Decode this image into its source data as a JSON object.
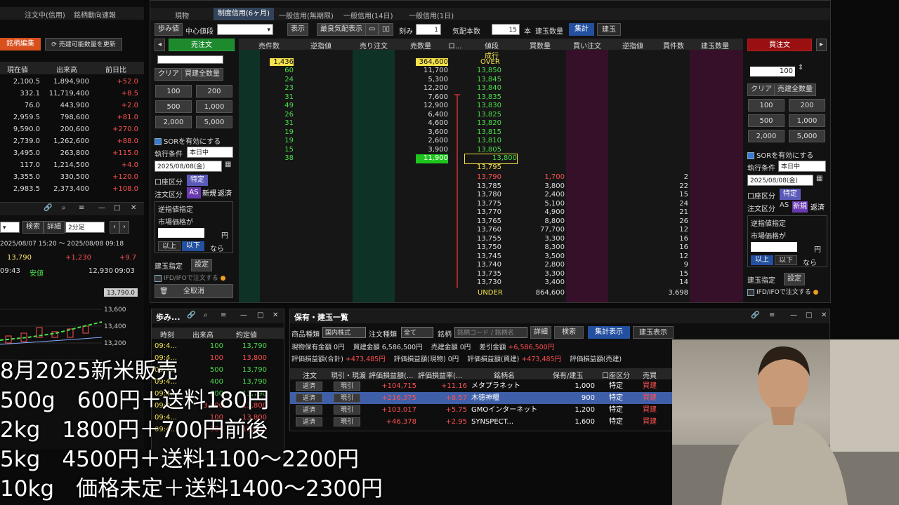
{
  "top_left_tabs": [
    "注文中(信用)",
    "銘柄動向速報"
  ],
  "left_list": {
    "edit_btn": "銘柄編集",
    "update_btn": "売建可能数量を更新",
    "headers": [
      "現在値",
      "出来高",
      "前日比"
    ],
    "rows": [
      {
        "price": "2,100.5",
        "vol": "1,894,900",
        "chg": "+52.0"
      },
      {
        "price": "332.1",
        "vol": "11,719,400",
        "chg": "+8.5"
      },
      {
        "price": "76.0",
        "vol": "443,900",
        "chg": "+2.0"
      },
      {
        "price": "2,959.5",
        "vol": "798,600",
        "chg": "+81.0"
      },
      {
        "price": "9,590.0",
        "vol": "200,600",
        "chg": "+270.0"
      },
      {
        "price": "2,739.0",
        "vol": "1,262,600",
        "chg": "+88.0"
      },
      {
        "price": "3,495.0",
        "vol": "263,800",
        "chg": "+115.0"
      },
      {
        "price": "117.0",
        "vol": "1,214,500",
        "chg": "+4.0"
      },
      {
        "price": "3,355.0",
        "vol": "330,500",
        "chg": "+120.0"
      },
      {
        "price": "2,983.5",
        "vol": "2,373,400",
        "chg": "+108.0"
      }
    ]
  },
  "chart_panel": {
    "search": "検索",
    "detail": "詳細",
    "interval": "2分足",
    "range": "2025/08/07 15:20 ～ 2025/08/08 09:18",
    "price": "13,790",
    "change": "+1,230",
    "change_pct": "+9.7",
    "time1": "09:43",
    "low_label": "安値",
    "low_value": "12,930",
    "low_time": "09:03",
    "current_tag": "13,790.0",
    "yticks": [
      "13,600",
      "13,400",
      "13,200"
    ]
  },
  "board": {
    "tabs": [
      "現物",
      "制度信用(6ヶ月)",
      "一般信用(無期限)",
      "一般信用(14日)",
      "一般信用(1日)"
    ],
    "active_tab": 1,
    "toolbar": {
      "ayumi": "歩み値",
      "center": "中心値段",
      "display": "表示",
      "best": "最良気配表示",
      "kizami": "刻み",
      "kizami_val": "1",
      "kehai_count_label": "気配本数",
      "kehai_count": "15",
      "hon": "本",
      "tategyoku_qty": "建玉数量",
      "shukei": "集計",
      "tategyoku": "建玉"
    },
    "sell_order_btn": "売注文",
    "buy_order_btn": "買注文",
    "columns": [
      "売件数",
      "逆指値",
      "売り注文",
      "売数量",
      "ロ...",
      "値段",
      "買数量",
      "買い注文",
      "逆指値",
      "買件数",
      "建玉数量"
    ],
    "top_row": {
      "label": "成行"
    },
    "over_row": {
      "count": "1,436",
      "qty": "364,600",
      "label": "OVER"
    },
    "ask_rows": [
      {
        "count": "60",
        "qty": "11,700",
        "price": "13,850"
      },
      {
        "count": "24",
        "qty": "5,300",
        "price": "13,845"
      },
      {
        "count": "23",
        "qty": "12,200",
        "price": "13,840"
      },
      {
        "count": "31",
        "qty": "7,600",
        "price": "13,835"
      },
      {
        "count": "49",
        "qty": "12,900",
        "price": "13,830"
      },
      {
        "count": "26",
        "qty": "6,400",
        "price": "13,825"
      },
      {
        "count": "31",
        "qty": "4,600",
        "price": "13,820"
      },
      {
        "count": "19",
        "qty": "3,600",
        "price": "13,815"
      },
      {
        "count": "19",
        "qty": "2,600",
        "price": "13,810"
      },
      {
        "count": "15",
        "qty": "3,900",
        "price": "13,805"
      },
      {
        "count": "38",
        "qty": "11,900",
        "price": "13,800"
      }
    ],
    "mid_price": "13,795",
    "bid_rows": [
      {
        "price": "13,790",
        "qty": "1,700",
        "count": "2"
      },
      {
        "price": "13,785",
        "qty": "3,800",
        "count": "22"
      },
      {
        "price": "13,780",
        "qty": "2,400",
        "count": "15"
      },
      {
        "price": "13,775",
        "qty": "5,100",
        "count": "24"
      },
      {
        "price": "13,770",
        "qty": "4,900",
        "count": "21"
      },
      {
        "price": "13,765",
        "qty": "8,800",
        "count": "26"
      },
      {
        "price": "13,760",
        "qty": "77,700",
        "count": "12"
      },
      {
        "price": "13,755",
        "qty": "3,300",
        "count": "16"
      },
      {
        "price": "13,750",
        "qty": "8,300",
        "count": "16"
      },
      {
        "price": "13,745",
        "qty": "3,500",
        "count": "12"
      },
      {
        "price": "13,740",
        "qty": "2,800",
        "count": "9"
      },
      {
        "price": "13,735",
        "qty": "3,300",
        "count": "15"
      },
      {
        "price": "13,730",
        "qty": "3,400",
        "count": "14"
      }
    ],
    "under_row": {
      "label": "UNDER",
      "qty": "864,600",
      "count": "3,698"
    }
  },
  "order_form": {
    "qty": "100",
    "clear": "クリア",
    "all_qty_left": "買建全数量",
    "all_qty_right": "売建全数量",
    "qty_buttons": [
      "100",
      "200",
      "500",
      "1,000",
      "2,000",
      "5,000"
    ],
    "sor": "SORを有効にする",
    "exec_label": "執行条件",
    "exec_value": "本日中",
    "date": "2025/08/08(金)",
    "account_label": "口座区分",
    "account_value": "特定",
    "order_type_label": "注文区分",
    "as": "AS",
    "new": "新規",
    "close": "返済",
    "stop_label": "逆指値指定",
    "market_label": "市場価格が",
    "yen": "円",
    "above": "以上",
    "below": "以下",
    "nara": "なら",
    "pos_label": "建玉指定",
    "set": "設定",
    "ifd": "IFD/IFOで注文する",
    "cancel_all": "全取消"
  },
  "ayumi_panel": {
    "title": "歩み...",
    "headers": [
      "時刻",
      "出来高",
      "約定値"
    ],
    "rows": [
      {
        "time": "09:4...",
        "vol": "100",
        "price": "13,790"
      },
      {
        "time": "09:4...",
        "vol": "100",
        "price": "13,800"
      },
      {
        "time": "09:4...",
        "vol": "500",
        "price": "13,790"
      },
      {
        "time": "09:4...",
        "vol": "400",
        "price": "13,790"
      },
      {
        "time": "09:4...",
        "vol": "300",
        "price": "13,790"
      },
      {
        "time": "09:4...",
        "vol": "3,600",
        "price": "13,800"
      },
      {
        "time": "09:4...",
        "vol": "100",
        "price": "13,800"
      },
      {
        "time": "09:4...",
        "vol": "500",
        "price": "13,800"
      }
    ]
  },
  "holdings": {
    "title": "保有・建玉一覧",
    "product_label": "商品種類",
    "product_value": "国内株式",
    "order_kind_label": "注文種類",
    "order_kind_value": "全て",
    "brand_label": "銘柄",
    "brand_placeholder": "銘柄コード / 銘柄名",
    "detail": "詳細",
    "search": "検索",
    "summary_btn": "集計表示",
    "pos_btn": "建玉表示",
    "summary1": [
      {
        "label": "現物保有金額",
        "value": "0円"
      },
      {
        "label": "買建金額",
        "value": "6,586,500円"
      },
      {
        "label": "売建金額",
        "value": "0円"
      },
      {
        "label": "差引金額",
        "value": "+6,586,500円"
      }
    ],
    "summary2": [
      {
        "label": "評価損益額(合計)",
        "value": "+473,485円"
      },
      {
        "label": "評価損益額(現物)",
        "value": "0円"
      },
      {
        "label": "評価損益額(買建)",
        "value": "+473,485円"
      },
      {
        "label": "評価損益額(売建)",
        "value": ""
      }
    ],
    "headers": [
      "注文",
      "現引・現渡",
      "評価損益額(...",
      "評価損益率(...",
      "銘柄名",
      "保有/建玉",
      "口座区分",
      "売買"
    ],
    "rows": [
      {
        "order": "返済",
        "genbiki": "現引",
        "pl": "+104,715",
        "rate": "+11.16",
        "name": "メタプラネット",
        "qty": "1,000",
        "acct": "特定",
        "side": "買建"
      },
      {
        "order": "返済",
        "genbiki": "現引",
        "pl": "+216,375",
        "rate": "+8.57",
        "name": "木徳神糧",
        "qty": "900",
        "acct": "特定",
        "side": "買建"
      },
      {
        "order": "返済",
        "genbiki": "現引",
        "pl": "+103,017",
        "rate": "+5.75",
        "name": "GMOインターネット",
        "qty": "1,200",
        "acct": "特定",
        "side": "買建"
      },
      {
        "order": "返済",
        "genbiki": "現引",
        "pl": "+46,378",
        "rate": "+2.95",
        "name": "SYNSPECT...",
        "qty": "1,600",
        "acct": "特定",
        "side": "買建"
      }
    ]
  },
  "captions": [
    "8月2025新米販売",
    "500g　600円＋送料180円",
    "2kg　1800円＋700円前後",
    "5kg　4500円＋送料1100～2200円",
    "10kg　価格未定＋送料1400～2300円"
  ],
  "colors": {
    "up": "#ff5050",
    "down": "#4ade4a",
    "yellow": "#f5e34a",
    "sell_bg": "#0d3a2a",
    "buy_bg": "#3a0d2e"
  }
}
